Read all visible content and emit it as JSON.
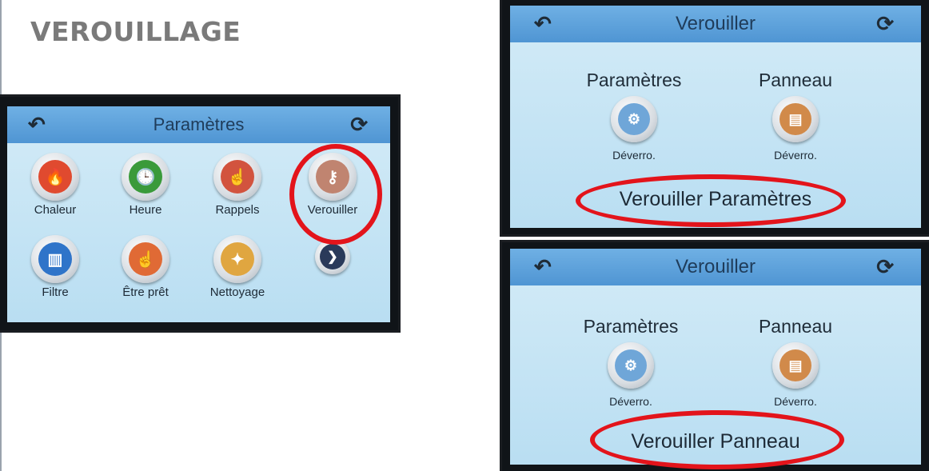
{
  "title": "VEROUILLAGE",
  "settings_screen": {
    "title": "Paramètres",
    "items": [
      {
        "label": "Chaleur",
        "icon": "flame-icon",
        "glyph": "🔥",
        "color": "#e04a2f"
      },
      {
        "label": "Heure",
        "icon": "clock-icon",
        "glyph": "🕒",
        "color": "#3a9a3a"
      },
      {
        "label": "Rappels",
        "icon": "reminder-icon",
        "glyph": "☝",
        "color": "#d2533e"
      },
      {
        "label": "Verouiller",
        "icon": "key-icon",
        "glyph": "⚷",
        "color": "#c08470"
      },
      {
        "label": "Filtre",
        "icon": "filter-icon",
        "glyph": "▥",
        "color": "#2f74c9"
      },
      {
        "label": "Être prêt",
        "icon": "ready-icon",
        "glyph": "☝",
        "color": "#e06a35"
      },
      {
        "label": "Nettoyage",
        "icon": "cleaning-icon",
        "glyph": "✦",
        "color": "#e0a640"
      },
      {
        "label": "",
        "icon": "chevron-right-icon",
        "glyph": "❯",
        "color": "#2a3a5a"
      }
    ]
  },
  "lock_screen_settings": {
    "title": "Verouiller",
    "settings_heading": "Paramètres",
    "settings_state": "Déverro.",
    "panel_heading": "Panneau",
    "panel_state": "Déverro.",
    "action_label": "Verouiller Paramètres"
  },
  "lock_screen_panel": {
    "title": "Verouiller",
    "settings_heading": "Paramètres",
    "settings_state": "Déverro.",
    "panel_heading": "Panneau",
    "panel_state": "Déverro.",
    "action_label": "Verouiller Panneau"
  },
  "icons": {
    "back": "↶",
    "refresh": "⟳",
    "settings_lock": "⚙",
    "panel_lock": "▤"
  },
  "colors": {
    "highlight": "#e3141b",
    "header": "#5aa0da",
    "screen_bg": "#c4e4f4"
  }
}
